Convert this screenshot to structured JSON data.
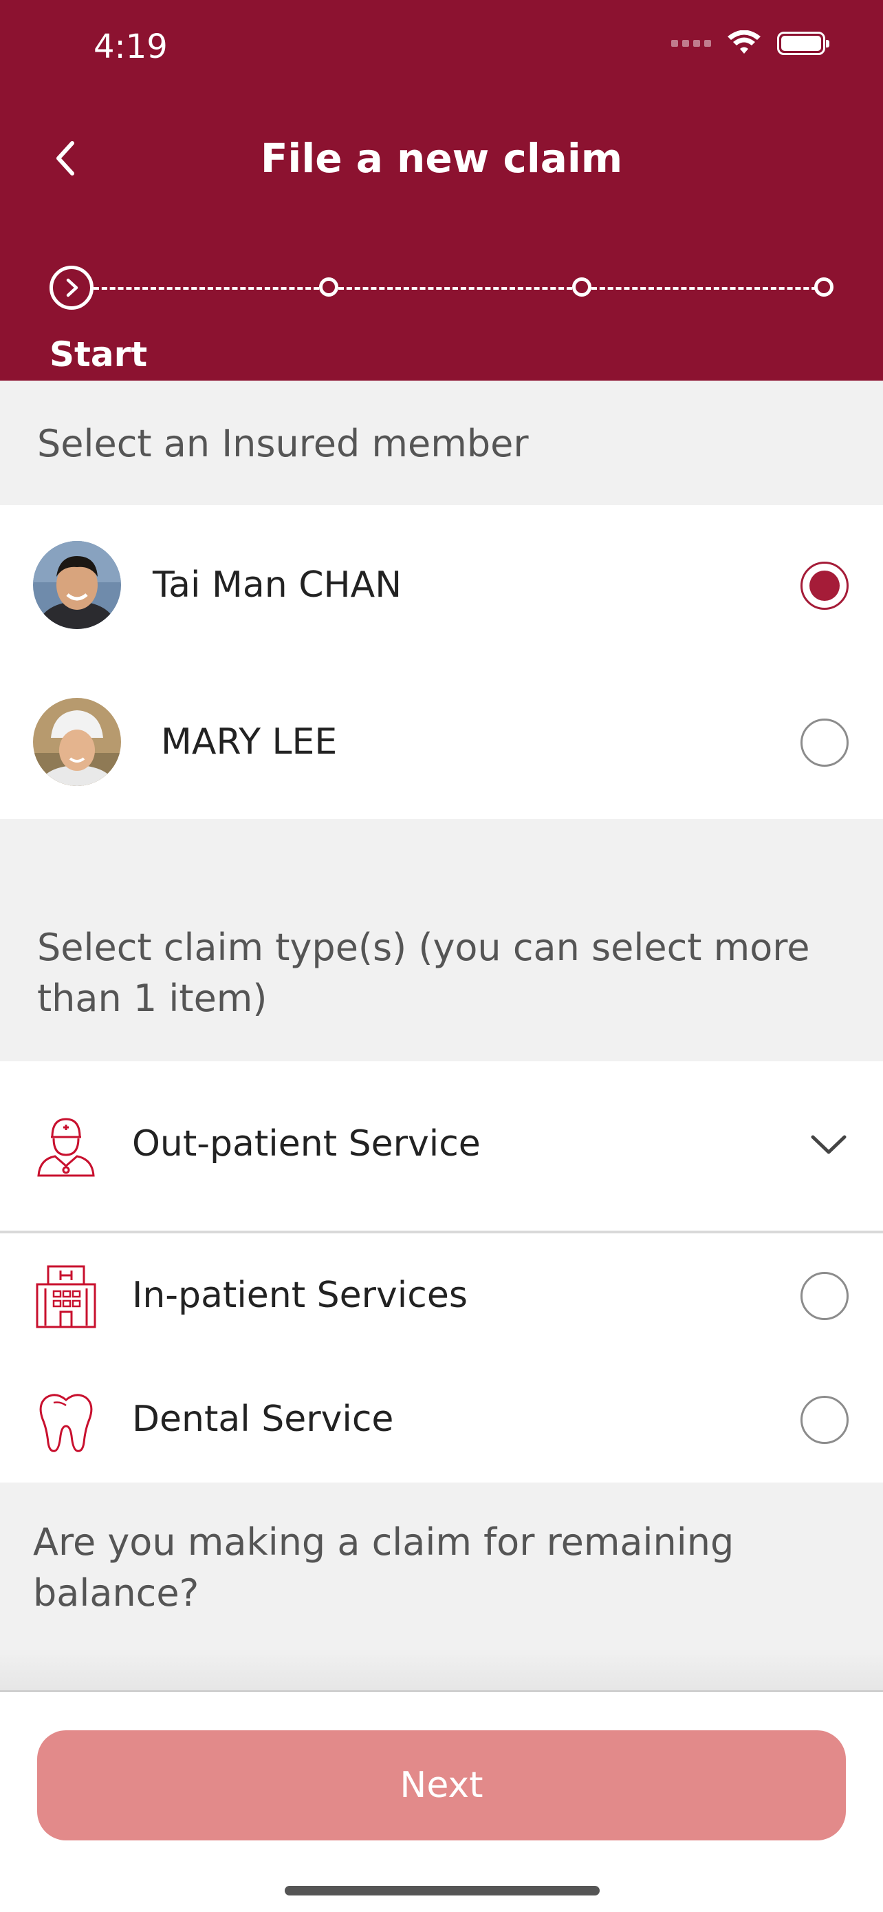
{
  "status_bar": {
    "time": "4:19"
  },
  "header": {
    "title": "File a new claim",
    "step_label": "Start"
  },
  "insured": {
    "heading": "Select an Insured member",
    "members": [
      {
        "name": "Tai Man CHAN",
        "selected": true
      },
      {
        "name": "MARY LEE",
        "selected": false
      }
    ]
  },
  "claim_types": {
    "heading": "Select claim type(s) (you can select more than 1 item)",
    "items": [
      {
        "label": "Out-patient Service",
        "icon": "doctor-icon",
        "control": "chevron-down"
      },
      {
        "label": "In-patient Services",
        "icon": "hospital-icon",
        "control": "radio"
      },
      {
        "label": "Dental Service",
        "icon": "tooth-icon",
        "control": "radio"
      }
    ]
  },
  "remaining_balance": {
    "question": "Are you making a claim for remaining balance?"
  },
  "footer": {
    "next_label": "Next"
  },
  "colors": {
    "brand": "#8c1230",
    "accent": "#a51c38",
    "button_disabled": "#e28a8a"
  }
}
